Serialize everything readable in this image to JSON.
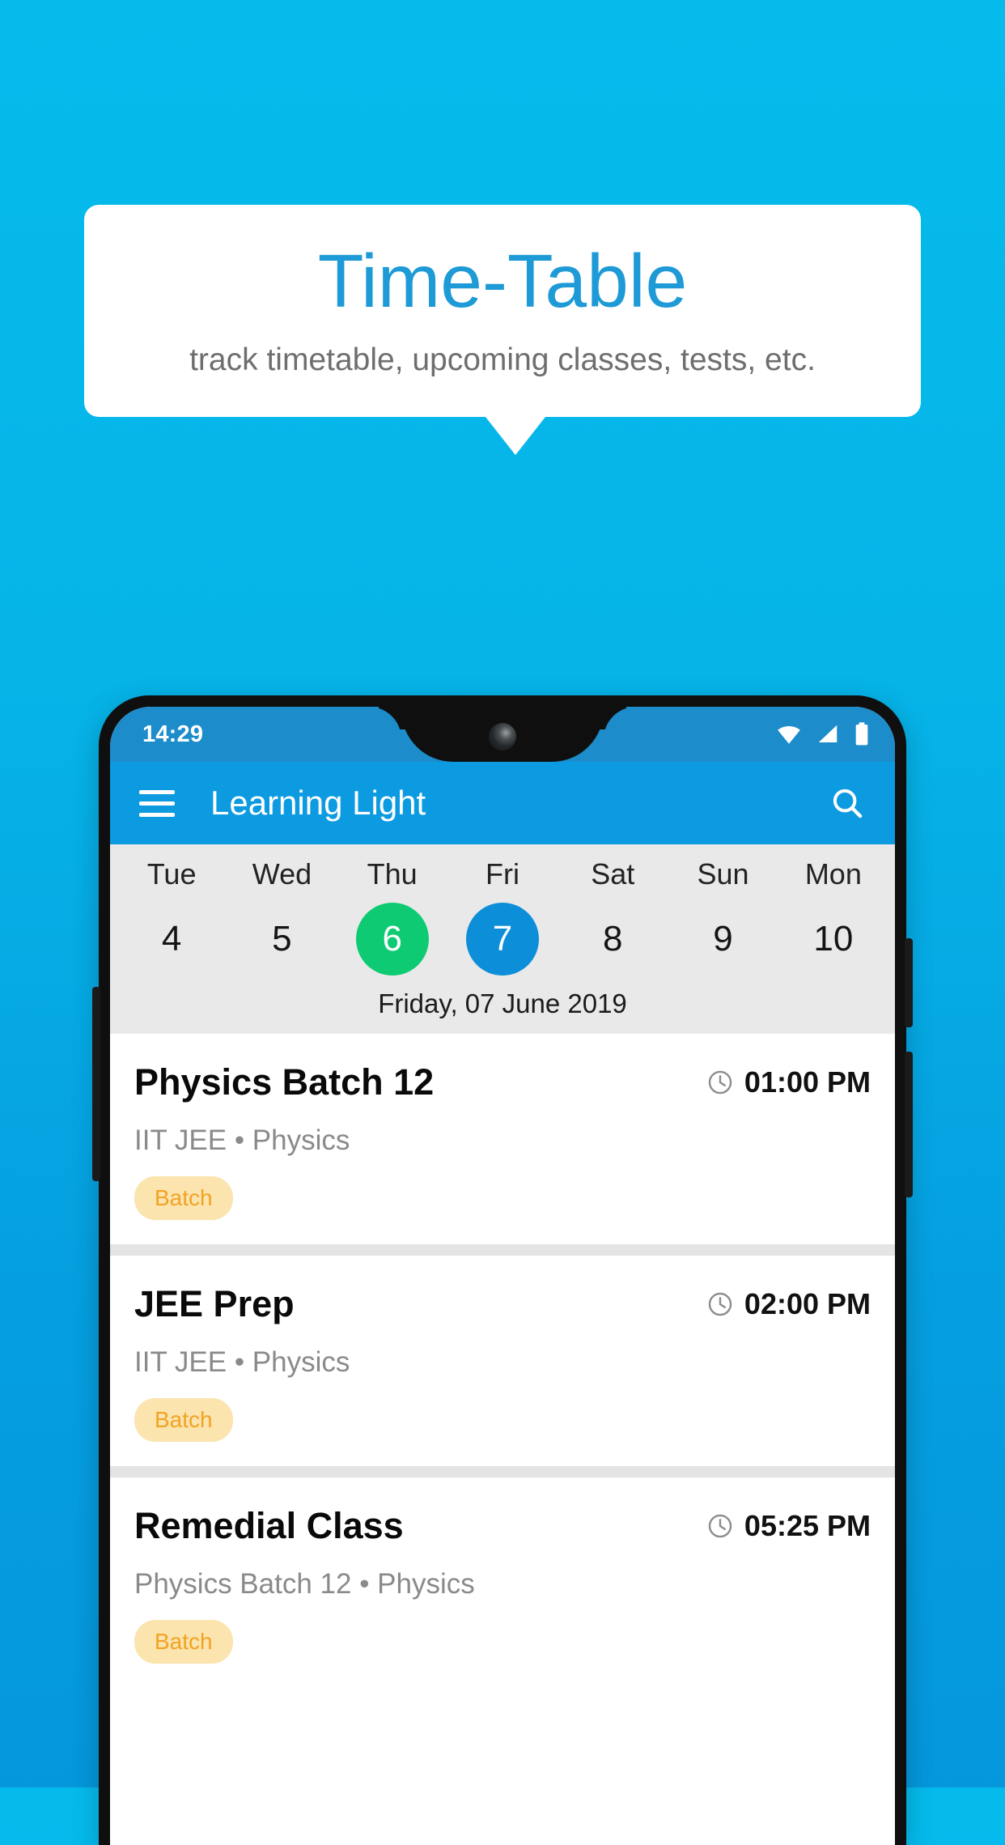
{
  "promo": {
    "title": "Time-Table",
    "subtitle": "track timetable, upcoming classes, tests, etc.",
    "title_color": "#1E9AD6",
    "background_color": "#06B4E8"
  },
  "phone": {
    "statusbar": {
      "time": "14:29",
      "icons": [
        "wifi-icon",
        "signal-icon",
        "battery-icon"
      ],
      "background_color": "#1C8CCB"
    },
    "appbar": {
      "menu_icon": "hamburger-menu-icon",
      "title": "Learning Light",
      "search_icon": "search-icon",
      "background_color": "#0C9AE0"
    },
    "daystrip": {
      "days": [
        {
          "day": "Tue",
          "num": "4",
          "state": "normal"
        },
        {
          "day": "Wed",
          "num": "5",
          "state": "normal"
        },
        {
          "day": "Thu",
          "num": "6",
          "state": "today",
          "color": "#0ECB73"
        },
        {
          "day": "Fri",
          "num": "7",
          "state": "selected",
          "color": "#0C8ED8"
        },
        {
          "day": "Sat",
          "num": "8",
          "state": "normal"
        },
        {
          "day": "Sun",
          "num": "9",
          "state": "normal"
        },
        {
          "day": "Mon",
          "num": "10",
          "state": "normal"
        }
      ],
      "selected_date_label": "Friday, 07 June 2019",
      "background_color": "#E9E9E9"
    },
    "classes": [
      {
        "title": "Physics Batch 12",
        "time": "01:00 PM",
        "subtitle": "IIT JEE • Physics",
        "chip": "Batch"
      },
      {
        "title": "JEE Prep",
        "time": "02:00 PM",
        "subtitle": "IIT JEE • Physics",
        "chip": "Batch"
      },
      {
        "title": "Remedial Class",
        "time": "05:25 PM",
        "subtitle": "Physics Batch 12 • Physics",
        "chip": "Batch"
      }
    ],
    "chip_colors": {
      "background": "#FBE4AE",
      "text": "#F2A324"
    }
  }
}
